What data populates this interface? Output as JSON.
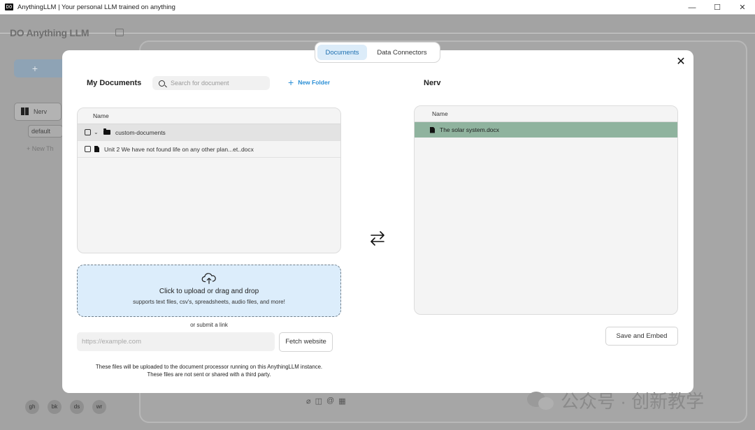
{
  "window": {
    "app_icon": "DO",
    "title": "AnythingLLM | Your personal LLM trained on anything",
    "minimize": "—",
    "maximize": "☐",
    "close": "✕"
  },
  "background": {
    "logo": "DO Anything LLM",
    "new_workspace_symbol": "+",
    "workspace_name": "Nerv",
    "thread_default": "default",
    "new_thread": "+ New Th",
    "footer_icons": [
      "gh",
      "bk",
      "ds",
      "wr"
    ],
    "composer_icons": [
      "paperclip-icon",
      "slash-icon",
      "at-icon",
      "text-icon"
    ]
  },
  "modal": {
    "tabs": [
      {
        "label": "Documents",
        "active": true
      },
      {
        "label": "Data Connectors",
        "active": false
      }
    ],
    "close_symbol": "✕",
    "left_title": "My Documents",
    "search_placeholder": "Search for document",
    "new_folder_symbol": "+",
    "new_folder_label": "New Folder",
    "column_name": "Name",
    "documents": [
      {
        "type": "folder",
        "name": "custom-documents"
      },
      {
        "type": "file",
        "name": "Unit 2 We have not found life on any other plan...et..docx"
      }
    ],
    "upload": {
      "title": "Click to upload or drag and drop",
      "subtitle": "supports text files, csv's, spreadsheets, audio files, and more!"
    },
    "or_submit_link": "or submit a link",
    "url_placeholder": "https://example.com",
    "fetch_button": "Fetch website",
    "disclaimer_line1": "These files will be uploaded to the document processor running on this AnythingLLM instance.",
    "disclaimer_line2": "These files are not sent or shared with a third party.",
    "right_title": "Nerv",
    "workspace_column_name": "Name",
    "workspace_documents": [
      {
        "name": "The solar system.docx"
      }
    ],
    "save_button": "Save and Embed"
  },
  "watermark": {
    "text": "公众号 · 创新教学"
  },
  "colors": {
    "accent": "#2b8fd6",
    "active_tab_bg": "#dcecf9",
    "upload_bg": "#dcedfb",
    "selected_row": "#8fb39e"
  }
}
